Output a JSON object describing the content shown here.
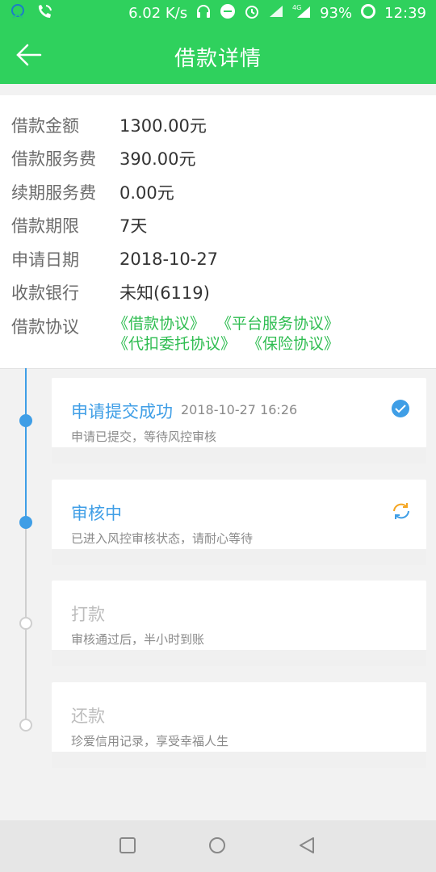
{
  "status_bar": {
    "speed": "6.02 K/s",
    "battery": "93%",
    "time": "12:39",
    "network": "4G"
  },
  "header": {
    "title": "借款详情",
    "back_icon": "arrow-left-icon"
  },
  "details": [
    {
      "label": "借款金额",
      "value": "1300.00元"
    },
    {
      "label": "借款服务费",
      "value": "390.00元"
    },
    {
      "label": "续期服务费",
      "value": "0.00元"
    },
    {
      "label": "借款期限",
      "value": "7天"
    },
    {
      "label": "申请日期",
      "value": "2018-10-27"
    },
    {
      "label": "收款银行",
      "value": "未知(6119)"
    }
  ],
  "agreements": {
    "label": "借款协议",
    "links": [
      "《借款协议》",
      "《平台服务协议》",
      "《代扣委托协议》",
      "《保险协议》"
    ]
  },
  "timeline": [
    {
      "title": "申请提交成功",
      "time": "2018-10-27 16:26",
      "desc": "申请已提交，等待风控审核",
      "state": "done",
      "icon": "check-circle-icon"
    },
    {
      "title": "审核中",
      "time": "",
      "desc": "已进入风控审核状态，请耐心等待",
      "state": "active",
      "icon": "refresh-icon"
    },
    {
      "title": "打款",
      "time": "",
      "desc": "审核通过后，半小时到账",
      "state": "pending",
      "icon": ""
    },
    {
      "title": "还款",
      "time": "",
      "desc": "珍爱信用记录，享受幸福人生",
      "state": "pending",
      "icon": ""
    }
  ],
  "colors": {
    "brand_green": "#2fd15d",
    "active_blue": "#3f9ee6",
    "agreement_green": "#2fbd51",
    "refresh_orange": "#f5a623"
  }
}
